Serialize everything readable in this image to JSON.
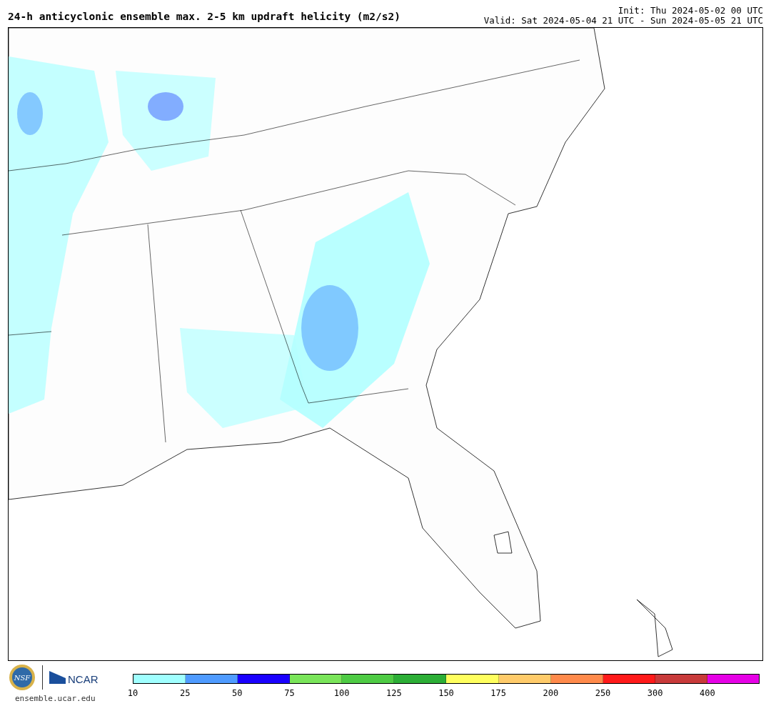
{
  "header": {
    "title": "24-h anticyclonic ensemble max. 2-5 km updraft helicity (m2/s2)",
    "init": "Init: Thu 2024-05-02 00 UTC",
    "valid": "Valid: Sat 2024-05-04 21 UTC - Sun 2024-05-05 21 UTC"
  },
  "footer": {
    "nsf_logo": "NSF",
    "ncar_logo": "NCAR",
    "site": "ensemble.ucar.edu"
  },
  "colorbar": {
    "bins": [
      {
        "color": "#a0ffff",
        "tick": "10"
      },
      {
        "color": "#4f9bff",
        "tick": "25"
      },
      {
        "color": "#1a00ff",
        "tick": "50"
      },
      {
        "color": "#7ae55a",
        "tick": "75"
      },
      {
        "color": "#4ecb44",
        "tick": "100"
      },
      {
        "color": "#2cae36",
        "tick": "125"
      },
      {
        "color": "#ffff5e",
        "tick": "150"
      },
      {
        "color": "#ffcb6a",
        "tick": "175"
      },
      {
        "color": "#ff8a4b",
        "tick": "200"
      },
      {
        "color": "#ff1a1a",
        "tick": "250"
      },
      {
        "color": "#c83a3a",
        "tick": "300"
      },
      {
        "color": "#e600e6",
        "tick": "400"
      }
    ]
  }
}
